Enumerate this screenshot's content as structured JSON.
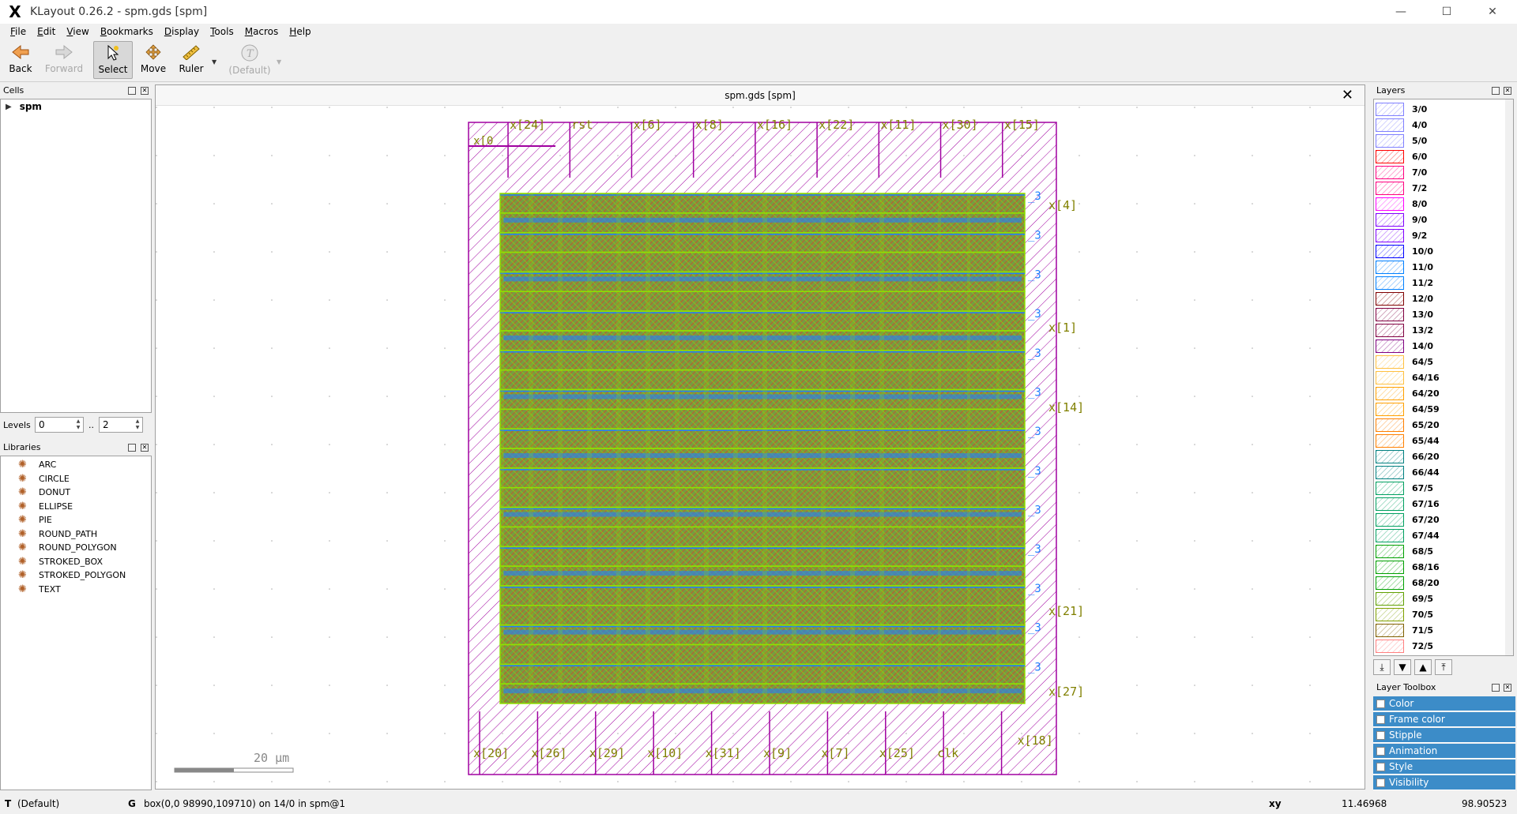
{
  "window": {
    "title": "KLayout 0.26.2 - spm.gds [spm]",
    "minimize": "—",
    "maximize": "☐",
    "close": "✕"
  },
  "menu": [
    {
      "u": "F",
      "rest": "ile"
    },
    {
      "u": "E",
      "rest": "dit"
    },
    {
      "u": "V",
      "rest": "iew"
    },
    {
      "u": "B",
      "rest": "ookmarks"
    },
    {
      "u": "D",
      "rest": "isplay"
    },
    {
      "u": "T",
      "rest": "ools"
    },
    {
      "u": "M",
      "rest": "acros"
    },
    {
      "u": "H",
      "rest": "elp"
    }
  ],
  "toolbar": {
    "back": "Back",
    "forward": "Forward",
    "select": "Select",
    "move": "Move",
    "ruler": "Ruler",
    "text_default": "(Default)"
  },
  "cells_panel": {
    "title": "Cells",
    "root_cell": "spm",
    "levels_label": "Levels",
    "level_from": "0",
    "level_sep": "..",
    "level_to": "2"
  },
  "libraries_panel": {
    "title": "Libraries",
    "items": [
      "ARC",
      "CIRCLE",
      "DONUT",
      "ELLIPSE",
      "PIE",
      "ROUND_PATH",
      "ROUND_POLYGON",
      "STROKED_BOX",
      "STROKED_POLYGON",
      "TEXT"
    ]
  },
  "canvas": {
    "tab_title": "spm.gds [spm]",
    "scale_label": "20 µm",
    "top_pins": [
      "x[24]",
      "rst",
      "x[6]",
      "x[8]",
      "x[16]",
      "x[22]",
      "x[11]",
      "x[30]",
      "x[15]"
    ],
    "bottom_pins": [
      "x[20]",
      "x[26]",
      "x[29]",
      "x[10]",
      "x[31]",
      "x[9]",
      "x[7]",
      "x[25]",
      "clk",
      "x[18]"
    ],
    "right_labels": [
      "x[4]",
      "x[1]",
      "x[14]",
      "x[27]",
      "x[21]"
    ],
    "rail_label": "_3",
    "left_pin": "x[0"
  },
  "layers_panel": {
    "title": "Layers",
    "layers": [
      {
        "name": "3/0",
        "color": "#8080ff"
      },
      {
        "name": "4/0",
        "color": "#8080ff"
      },
      {
        "name": "5/0",
        "color": "#8080ff"
      },
      {
        "name": "6/0",
        "color": "#ff0000"
      },
      {
        "name": "7/0",
        "color": "#ff0080"
      },
      {
        "name": "7/2",
        "color": "#ff0080"
      },
      {
        "name": "8/0",
        "color": "#ff00ff"
      },
      {
        "name": "9/0",
        "color": "#8000ff"
      },
      {
        "name": "9/2",
        "color": "#8000ff"
      },
      {
        "name": "10/0",
        "color": "#0000ff"
      },
      {
        "name": "11/0",
        "color": "#0080ff"
      },
      {
        "name": "11/2",
        "color": "#0080ff"
      },
      {
        "name": "12/0",
        "color": "#800000"
      },
      {
        "name": "13/0",
        "color": "#800040"
      },
      {
        "name": "13/2",
        "color": "#800040"
      },
      {
        "name": "14/0",
        "color": "#800080"
      },
      {
        "name": "64/5",
        "color": "#ffc040"
      },
      {
        "name": "64/16",
        "color": "#ffc040"
      },
      {
        "name": "64/20",
        "color": "#ffa000"
      },
      {
        "name": "64/59",
        "color": "#ffa000"
      },
      {
        "name": "65/20",
        "color": "#ff8000"
      },
      {
        "name": "65/44",
        "color": "#ff8000"
      },
      {
        "name": "66/20",
        "color": "#008080"
      },
      {
        "name": "66/44",
        "color": "#008080"
      },
      {
        "name": "67/5",
        "color": "#00a060"
      },
      {
        "name": "67/16",
        "color": "#00a060"
      },
      {
        "name": "67/20",
        "color": "#00a060"
      },
      {
        "name": "67/44",
        "color": "#00a060"
      },
      {
        "name": "68/5",
        "color": "#00a000"
      },
      {
        "name": "68/16",
        "color": "#00a000"
      },
      {
        "name": "68/20",
        "color": "#00a000"
      },
      {
        "name": "69/5",
        "color": "#60a000"
      },
      {
        "name": "70/5",
        "color": "#80a000"
      },
      {
        "name": "71/5",
        "color": "#806000"
      },
      {
        "name": "72/5",
        "color": "#ff8080"
      }
    ]
  },
  "layer_toolbox": {
    "title": "Layer Toolbox",
    "items": [
      "Color",
      "Frame color",
      "Stipple",
      "Animation",
      "Style",
      "Visibility"
    ]
  },
  "status": {
    "mode_key": "T",
    "mode_value": "(Default)",
    "grid_key": "G",
    "selection": "box(0,0 98990,109710) on 14/0 in spm@1",
    "xy_label": "xy",
    "x": "11.46968",
    "y": "98.90523"
  },
  "colors": {
    "boundary": "#a000a0",
    "metal_green": "#90e000",
    "metal_blue": "#2080ff",
    "poly_red": "#ff2020",
    "pin_label": "#808000",
    "toolbox_blue": "#3c8cc8"
  }
}
